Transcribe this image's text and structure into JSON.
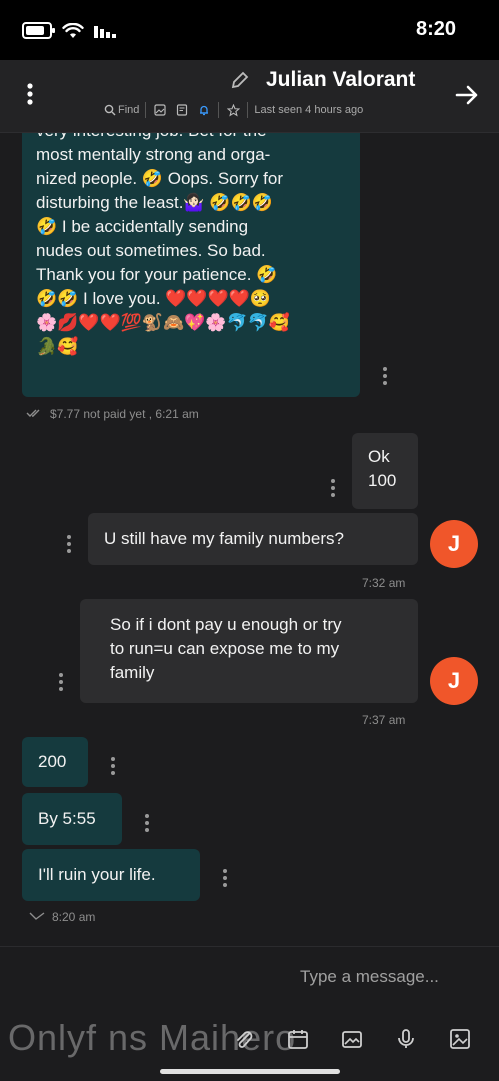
{
  "status": {
    "time": "8:20"
  },
  "header": {
    "title": "Julian Valorant",
    "subtitle": "Last seen 4 hours ago",
    "find_label": "Find"
  },
  "messages": {
    "m1_lines": [
      "very interesting job. Bet for the",
      "most mentally strong and orga-",
      "nized people. 🤣 Oops. Sorry for",
      "disturbing the least.🤷🏻‍♀️ 🤣🤣🤣",
      "🤣 I be accidentally sending",
      "nudes out sometimes. So bad.",
      "Thank you for your patience. 🤣",
      "🤣🤣 I love you. ❤️❤️❤️❤️🥺",
      "🌸💋❤️❤️💯🐒🙈💖🌸🐬🐬🥰",
      "🐊🥰"
    ],
    "m1_meta": "$7.77 not paid yet , 6:21 am",
    "m2_lines": [
      "Ok",
      "100"
    ],
    "m3_text": "U still have my family numbers?",
    "m3_time": "7:32 am",
    "m4_lines": [
      "So if i dont pay u enough or try",
      "to run=u can expose me to my",
      "family"
    ],
    "m4_time": "7:37 am",
    "m5_text": "200",
    "m6_text": "By 5:55",
    "m7_text": "I'll ruin your life.",
    "m7_time": "8:20 am",
    "avatar_letter": "J"
  },
  "composer": {
    "placeholder": "Type a message...",
    "watermark": "Onlyf ns Maihero"
  },
  "colors": {
    "out_bubble": "#153a3e",
    "in_bubble": "#2d2d2f",
    "avatar": "#f0562a",
    "accent": "#3a9bff"
  }
}
